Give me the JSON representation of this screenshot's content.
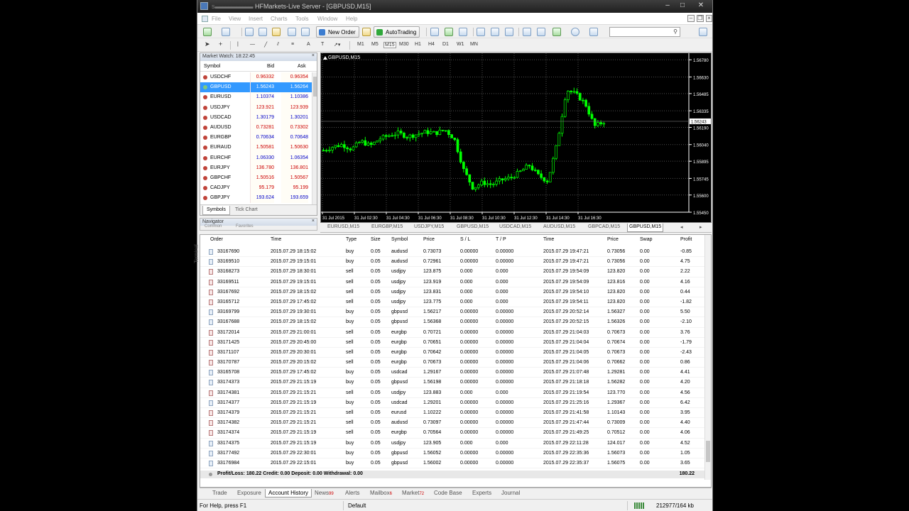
{
  "window": {
    "title": "HFMarkets-Live Server - [GBPUSD,M15]",
    "title_prefix_redacted": "ѕ▬▬▬▬▬▬",
    "controls": [
      "–",
      "□",
      "✕"
    ]
  },
  "menu": [
    "File",
    "View",
    "Insert",
    "Charts",
    "Tools",
    "Window",
    "Help"
  ],
  "toolbar": {
    "new_order": "New Order",
    "autotrading": "AutoTrading",
    "timeframes": [
      "M1",
      "M5",
      "M15",
      "M30",
      "H1",
      "H4",
      "D1",
      "W1",
      "MN"
    ],
    "search_placeholder": ""
  },
  "market_watch": {
    "title": "Market Watch: 18:22:45",
    "close": "×",
    "columns": [
      "Symbol",
      "Bid",
      "Ask"
    ],
    "rows": [
      {
        "symbol": "USDCHF",
        "bid": "0.96332",
        "ask": "0.96354",
        "dir": "dn"
      },
      {
        "symbol": "GBPUSD",
        "bid": "1.56243",
        "ask": "1.56264",
        "dir": "sel"
      },
      {
        "symbol": "EURUSD",
        "bid": "1.10374",
        "ask": "1.10386",
        "dir": "up"
      },
      {
        "symbol": "USDJPY",
        "bid": "123.921",
        "ask": "123.939",
        "dir": "dn"
      },
      {
        "symbol": "USDCAD",
        "bid": "1.30179",
        "ask": "1.30201",
        "dir": "up"
      },
      {
        "symbol": "AUDUSD",
        "bid": "0.73281",
        "ask": "0.73302",
        "dir": "dn"
      },
      {
        "symbol": "EURGBP",
        "bid": "0.70634",
        "ask": "0.70648",
        "dir": "up"
      },
      {
        "symbol": "EURAUD",
        "bid": "1.50581",
        "ask": "1.50630",
        "dir": "dn"
      },
      {
        "symbol": "EURCHF",
        "bid": "1.06330",
        "ask": "1.06354",
        "dir": "up"
      },
      {
        "symbol": "EURJPY",
        "bid": "136.780",
        "ask": "136.801",
        "dir": "dn"
      },
      {
        "symbol": "GBPCHF",
        "bid": "1.50516",
        "ask": "1.50567",
        "dir": "dn"
      },
      {
        "symbol": "CADJPY",
        "bid": "95.179",
        "ask": "95.199",
        "dir": "dn"
      },
      {
        "symbol": "GBPJPY",
        "bid": "193.624",
        "ask": "193.659",
        "dir": "up"
      }
    ],
    "tabs": [
      "Symbols",
      "Tick Chart"
    ]
  },
  "navigator": {
    "title": "Navigator",
    "close": "×",
    "tabs": [
      "Common",
      "Favorites"
    ]
  },
  "chart": {
    "title": "GBPUSD,M15",
    "price_labels": [
      "1.56780",
      "1.56630",
      "1.56485",
      "1.56335",
      "1.56190",
      "1.56040",
      "1.55895",
      "1.55745",
      "1.55600",
      "1.55450"
    ],
    "current_price": "1.56243",
    "time_labels": [
      "31 Jul 2015",
      "31 Jul 02:30",
      "31 Jul 04:30",
      "31 Jul 06:30",
      "31 Jul 08:30",
      "31 Jul 10:30",
      "31 Jul 12:30",
      "31 Jul 14:30",
      "31 Jul 16:30"
    ],
    "up_color": "#00ff00",
    "down_color": "#00ff00",
    "grid_color": "#4d4d4d"
  },
  "chart_data": {
    "type": "candlestick",
    "title": "GBPUSD,M15",
    "x": [
      "31 Jul 2015",
      "31 Jul 02:30",
      "31 Jul 04:30",
      "31 Jul 06:30",
      "31 Jul 08:30",
      "31 Jul 10:30",
      "31 Jul 12:30",
      "31 Jul 14:30",
      "31 Jul 16:30"
    ],
    "ylim": [
      1.5545,
      1.568
    ],
    "grid": true,
    "close_path": [
      1.5599,
      1.5602,
      1.5604,
      1.56,
      1.5607,
      1.5603,
      1.5609,
      1.5612,
      1.5614,
      1.5611,
      1.5613,
      1.5615,
      1.5614,
      1.5617,
      1.5609,
      1.5582,
      1.5566,
      1.5571,
      1.5569,
      1.5573,
      1.5575,
      1.558,
      1.5586,
      1.5577,
      1.5572,
      1.5605,
      1.5652,
      1.5648,
      1.564,
      1.562,
      1.5624
    ]
  },
  "chart_tabs": [
    "EURUSD,M15",
    "EURGBP,M15",
    "USDJPY,M15",
    "GBPUSD,M15",
    "USDCAD,M15",
    "AUDUSD,M15",
    "GBPCAD,M15",
    "GBPUSD,M15"
  ],
  "history": {
    "columns": [
      "Order",
      "Time",
      "Type",
      "Size",
      "Symbol",
      "Price",
      "S / L",
      "T / P",
      "Time",
      "Price",
      "Swap",
      "Profit"
    ],
    "rows": [
      [
        "33167690",
        "2015.07.29 18:15:02",
        "buy",
        "0.05",
        "audusd",
        "0.73073",
        "0.00000",
        "0.00000",
        "2015.07.29 19:47:21",
        "0.73056",
        "0.00",
        "-0.85"
      ],
      [
        "33169510",
        "2015.07.29 19:15:01",
        "buy",
        "0.05",
        "audusd",
        "0.72961",
        "0.00000",
        "0.00000",
        "2015.07.29 19:47:21",
        "0.73056",
        "0.00",
        "4.75"
      ],
      [
        "33168273",
        "2015.07.29 18:30:01",
        "sell",
        "0.05",
        "usdjpy",
        "123.875",
        "0.000",
        "0.000",
        "2015.07.29 19:54:09",
        "123.820",
        "0.00",
        "2.22"
      ],
      [
        "33169511",
        "2015.07.29 19:15:01",
        "sell",
        "0.05",
        "usdjpy",
        "123.919",
        "0.000",
        "0.000",
        "2015.07.29 19:54:09",
        "123.816",
        "0.00",
        "4.16"
      ],
      [
        "33167692",
        "2015.07.29 18:15:02",
        "sell",
        "0.05",
        "usdjpy",
        "123.831",
        "0.000",
        "0.000",
        "2015.07.29 19:54:10",
        "123.820",
        "0.00",
        "0.44"
      ],
      [
        "33165712",
        "2015.07.29 17:45:02",
        "sell",
        "0.05",
        "usdjpy",
        "123.775",
        "0.000",
        "0.000",
        "2015.07.29 19:54:11",
        "123.820",
        "0.00",
        "-1.82"
      ],
      [
        "33169799",
        "2015.07.29 19:30:01",
        "buy",
        "0.05",
        "gbpusd",
        "1.56217",
        "0.00000",
        "0.00000",
        "2015.07.29 20:52:14",
        "1.56327",
        "0.00",
        "5.50"
      ],
      [
        "33167688",
        "2015.07.29 18:15:02",
        "buy",
        "0.05",
        "gbpusd",
        "1.56368",
        "0.00000",
        "0.00000",
        "2015.07.29 20:52:15",
        "1.56326",
        "0.00",
        "-2.10"
      ],
      [
        "33172014",
        "2015.07.29 21:00:01",
        "sell",
        "0.05",
        "eurgbp",
        "0.70721",
        "0.00000",
        "0.00000",
        "2015.07.29 21:04:03",
        "0.70673",
        "0.00",
        "3.76"
      ],
      [
        "33171425",
        "2015.07.29 20:45:00",
        "sell",
        "0.05",
        "eurgbp",
        "0.70651",
        "0.00000",
        "0.00000",
        "2015.07.29 21:04:04",
        "0.70674",
        "0.00",
        "-1.79"
      ],
      [
        "33171107",
        "2015.07.29 20:30:01",
        "sell",
        "0.05",
        "eurgbp",
        "0.70642",
        "0.00000",
        "0.00000",
        "2015.07.29 21:04:05",
        "0.70673",
        "0.00",
        "-2.43"
      ],
      [
        "33170787",
        "2015.07.29 20:15:02",
        "sell",
        "0.05",
        "eurgbp",
        "0.70673",
        "0.00000",
        "0.00000",
        "2015.07.29 21:04:06",
        "0.70662",
        "0.00",
        "0.86"
      ],
      [
        "33165708",
        "2015.07.29 17:45:02",
        "buy",
        "0.05",
        "usdcad",
        "1.29167",
        "0.00000",
        "0.00000",
        "2015.07.29 21:07:48",
        "1.29281",
        "0.00",
        "4.41"
      ],
      [
        "33174373",
        "2015.07.29 21:15:19",
        "buy",
        "0.05",
        "gbpusd",
        "1.56198",
        "0.00000",
        "0.00000",
        "2015.07.29 21:18:18",
        "1.56282",
        "0.00",
        "4.20"
      ],
      [
        "33174381",
        "2015.07.29 21:15:21",
        "sell",
        "0.05",
        "usdjpy",
        "123.883",
        "0.000",
        "0.000",
        "2015.07.29 21:19:54",
        "123.770",
        "0.00",
        "4.56"
      ],
      [
        "33174377",
        "2015.07.29 21:15:19",
        "buy",
        "0.05",
        "usdcad",
        "1.29201",
        "0.00000",
        "0.00000",
        "2015.07.29 21:25:16",
        "1.29367",
        "0.00",
        "6.42"
      ],
      [
        "33174379",
        "2015.07.29 21:15:21",
        "sell",
        "0.05",
        "eurusd",
        "1.10222",
        "0.00000",
        "0.00000",
        "2015.07.29 21:41:58",
        "1.10143",
        "0.00",
        "3.95"
      ],
      [
        "33174382",
        "2015.07.29 21:15:21",
        "sell",
        "0.05",
        "audusd",
        "0.73097",
        "0.00000",
        "0.00000",
        "2015.07.29 21:47:44",
        "0.73009",
        "0.00",
        "4.40"
      ],
      [
        "33174374",
        "2015.07.29 21:15:19",
        "sell",
        "0.05",
        "eurgbp",
        "0.70564",
        "0.00000",
        "0.00000",
        "2015.07.29 21:49:25",
        "0.70512",
        "0.00",
        "4.06"
      ],
      [
        "33174375",
        "2015.07.29 21:15:19",
        "buy",
        "0.05",
        "usdjpy",
        "123.905",
        "0.000",
        "0.000",
        "2015.07.29 22:11:28",
        "124.017",
        "0.00",
        "4.52"
      ],
      [
        "33177492",
        "2015.07.29 22:30:01",
        "buy",
        "0.05",
        "gbpusd",
        "1.56052",
        "0.00000",
        "0.00000",
        "2015.07.29 22:35:36",
        "1.56073",
        "0.00",
        "1.05"
      ],
      [
        "33176984",
        "2015.07.29 22:15:01",
        "buy",
        "0.05",
        "gbpusd",
        "1.56002",
        "0.00000",
        "0.00000",
        "2015.07.29 22:35:37",
        "1.56075",
        "0.00",
        "3.65"
      ]
    ],
    "totals_text": "Profit/Loss: 180.22  Credit: 0.00  Deposit: 0.00  Withdrawal: 0.00",
    "totals_value": "180.22"
  },
  "terminal_label": "Terminal",
  "terminal_tabs": [
    {
      "label": "Trade",
      "badge": ""
    },
    {
      "label": "Exposure",
      "badge": ""
    },
    {
      "label": "Account History",
      "badge": ""
    },
    {
      "label": "News",
      "badge": "99"
    },
    {
      "label": "Alerts",
      "badge": ""
    },
    {
      "label": "Mailbox",
      "badge": "6"
    },
    {
      "label": "Market",
      "badge": "72"
    },
    {
      "label": "Code Base",
      "badge": ""
    },
    {
      "label": "Experts",
      "badge": ""
    },
    {
      "label": "Journal",
      "badge": ""
    }
  ],
  "statusbar": {
    "help": "For Help, press F1",
    "profile": "Default",
    "traffic": "212977/164 kb"
  }
}
